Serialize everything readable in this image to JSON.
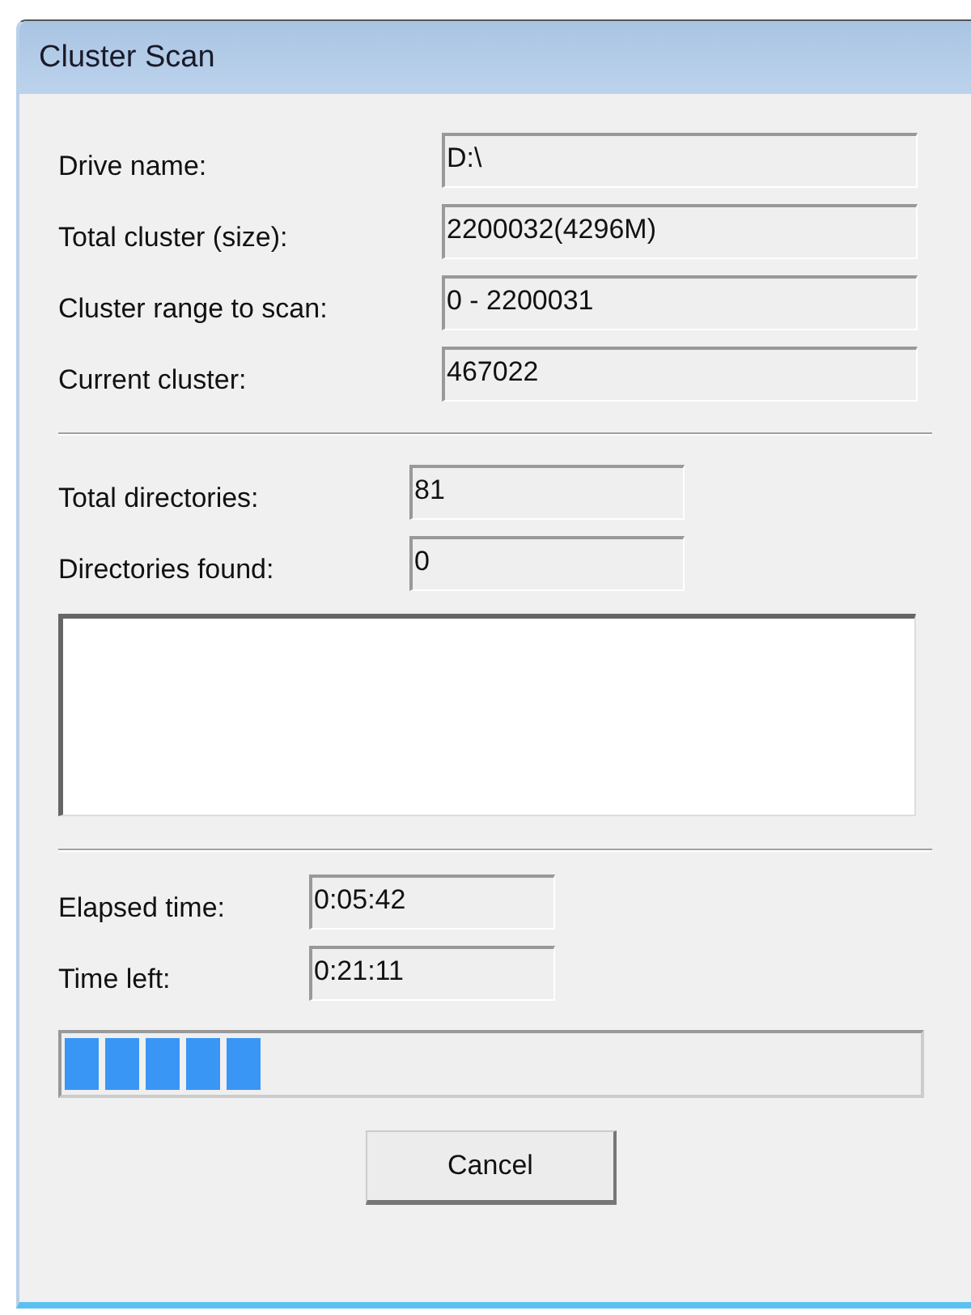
{
  "window": {
    "title": "Cluster Scan"
  },
  "drive_info": [
    {
      "label": "Drive name:",
      "value": "D:\\"
    },
    {
      "label": "Total cluster (size):",
      "value": "2200032(4296M)"
    },
    {
      "label": "Cluster range to scan:",
      "value": "0 - 2200031"
    },
    {
      "label": "Current cluster:",
      "value": "467022"
    }
  ],
  "directories": [
    {
      "label": "Total directories:",
      "value": "81"
    },
    {
      "label": "Directories found:",
      "value": "0"
    }
  ],
  "times": [
    {
      "label": "Elapsed time:",
      "value": "0:05:42"
    },
    {
      "label": "Time left:",
      "value": "0:21:11"
    }
  ],
  "progress": {
    "level": 0.23
  },
  "buttons": [
    "Cancel"
  ]
}
